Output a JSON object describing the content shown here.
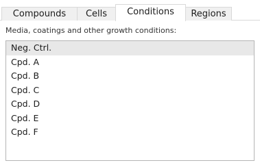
{
  "tabs": [
    {
      "label": "Compounds",
      "active": false
    },
    {
      "label": "Cells",
      "active": false
    },
    {
      "label": "Conditions",
      "active": true
    },
    {
      "label": "Regions",
      "active": false
    }
  ],
  "conditions_panel": {
    "description": "Media, coatings and other growth conditions:",
    "selected_index": 0,
    "items": [
      {
        "label": "Neg. Ctrl."
      },
      {
        "label": "Cpd. A"
      },
      {
        "label": "Cpd. B"
      },
      {
        "label": "Cpd. C"
      },
      {
        "label": "Cpd. D"
      },
      {
        "label": "Cpd. E"
      },
      {
        "label": "Cpd. F"
      }
    ]
  },
  "colors": {
    "selected_row": "#e8e8e8",
    "inactive_tab": "#f0f0f0",
    "border": "#b5b5b5"
  }
}
